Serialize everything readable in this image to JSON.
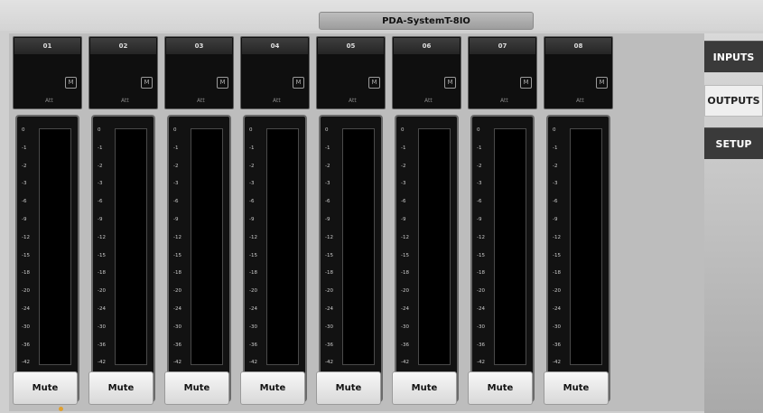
{
  "app": {
    "title": "PDA-SystemT-8IO"
  },
  "nav": [
    {
      "label": "INPUTS",
      "active": false
    },
    {
      "label": "OUTPUTS",
      "active": true
    },
    {
      "label": "SETUP",
      "active": false
    }
  ],
  "meter_scale": [
    "0",
    "-1",
    "-2",
    "-3",
    "-6",
    "-9",
    "-12",
    "-15",
    "-18",
    "-20",
    "-24",
    "-30",
    "-36",
    "-42"
  ],
  "channels": [
    {
      "number": "01",
      "att_label": "Att",
      "m_label": "M",
      "mute_label": "Mute"
    },
    {
      "number": "02",
      "att_label": "Att",
      "m_label": "M",
      "mute_label": "Mute"
    },
    {
      "number": "03",
      "att_label": "Att",
      "m_label": "M",
      "mute_label": "Mute"
    },
    {
      "number": "04",
      "att_label": "Att",
      "m_label": "M",
      "mute_label": "Mute"
    },
    {
      "number": "05",
      "att_label": "Att",
      "m_label": "M",
      "mute_label": "Mute"
    },
    {
      "number": "06",
      "att_label": "Att",
      "m_label": "M",
      "mute_label": "Mute"
    },
    {
      "number": "07",
      "att_label": "Att",
      "m_label": "M",
      "mute_label": "Mute"
    },
    {
      "number": "08",
      "att_label": "Att",
      "m_label": "M",
      "mute_label": "Mute"
    }
  ],
  "colors": {
    "background": "#cfcfcf",
    "panel": "#0f0f0f",
    "nav_dark": "#3a3a3a",
    "nav_active": "#efefef",
    "accent_dot": "#e0a030"
  }
}
